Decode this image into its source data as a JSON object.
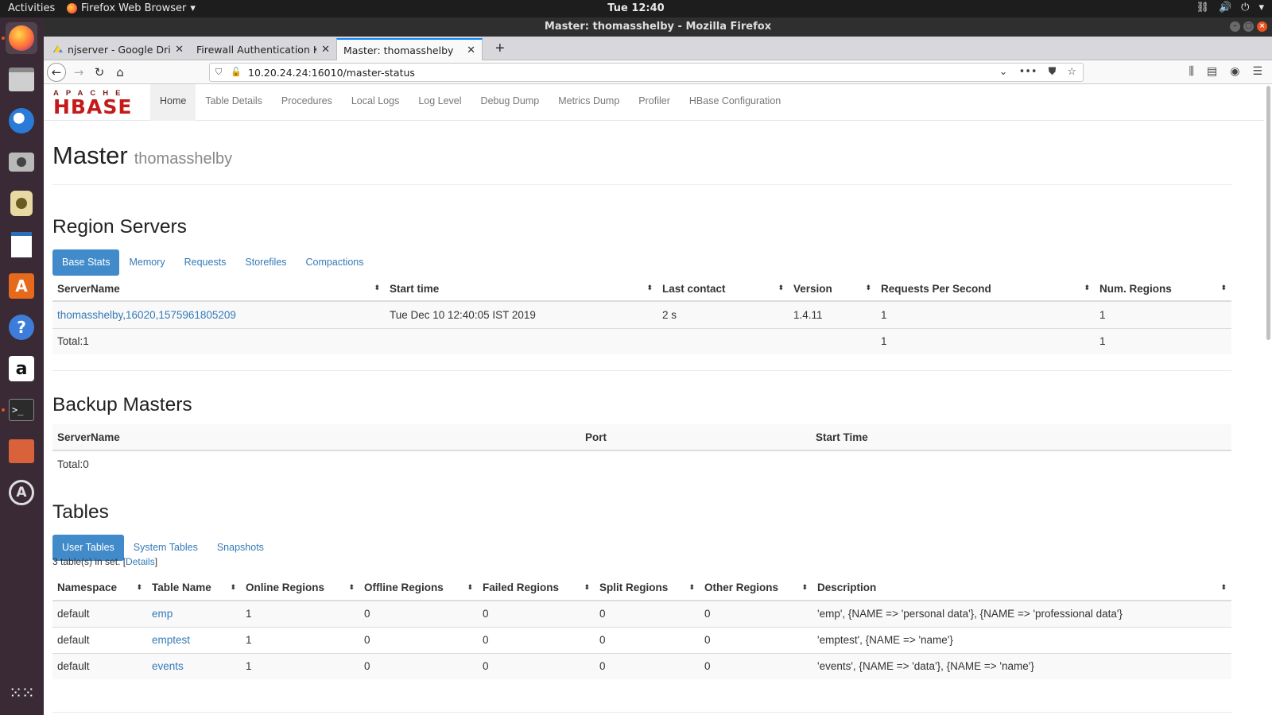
{
  "topbar": {
    "activities": "Activities",
    "app_menu": "Firefox Web Browser",
    "clock": "Tue 12:40"
  },
  "dock": {
    "items": [
      "firefox-icon",
      "files-icon",
      "thunderbird-icon",
      "screenshot-icon",
      "rhythmbox-icon",
      "writer-icon",
      "software-center-icon",
      "help-icon",
      "amazon-icon",
      "terminal-icon",
      "image-viewer-icon",
      "updater-icon",
      "app-grid-icon"
    ]
  },
  "window": {
    "title": "Master: thomasshelby - Mozilla Firefox"
  },
  "tabs": [
    {
      "label": "njserver - Google Drive"
    },
    {
      "label": "Firewall Authentication Kee"
    },
    {
      "label": "Master: thomasshelby"
    }
  ],
  "urlbar": {
    "url": "10.20.24.24:16010/master-status"
  },
  "hbase": {
    "logo_top": "APACHE",
    "logo_bottom": "HBASE",
    "nav": [
      "Home",
      "Table Details",
      "Procedures",
      "Local Logs",
      "Log Level",
      "Debug Dump",
      "Metrics Dump",
      "Profiler",
      "HBase Configuration"
    ]
  },
  "master": {
    "title": "Master",
    "hostname": "thomasshelby"
  },
  "region_servers": {
    "heading": "Region Servers",
    "tabs": [
      "Base Stats",
      "Memory",
      "Requests",
      "Storefiles",
      "Compactions"
    ],
    "columns": [
      "ServerName",
      "Start time",
      "Last contact",
      "Version",
      "Requests Per Second",
      "Num. Regions"
    ],
    "rows": [
      {
        "server": "thomasshelby,16020,1575961805209",
        "start": "Tue Dec 10 12:40:05 IST 2019",
        "last_contact": "2 s",
        "version": "1.4.11",
        "rps": "1",
        "regions": "1"
      }
    ],
    "total": {
      "label": "Total:1",
      "rps": "1",
      "regions": "1"
    }
  },
  "backup_masters": {
    "heading": "Backup Masters",
    "columns": [
      "ServerName",
      "Port",
      "Start Time"
    ],
    "total": "Total:0"
  },
  "tables": {
    "heading": "Tables",
    "tabs": [
      "User Tables",
      "System Tables",
      "Snapshots"
    ],
    "summary_prefix": "3 table(s) in set. [",
    "details_link": "Details",
    "summary_suffix": "]",
    "columns": [
      "Namespace",
      "Table Name",
      "Online Regions",
      "Offline Regions",
      "Failed Regions",
      "Split Regions",
      "Other Regions",
      "Description"
    ],
    "rows": [
      {
        "ns": "default",
        "name": "emp",
        "online": "1",
        "offline": "0",
        "failed": "0",
        "split": "0",
        "other": "0",
        "desc": "'emp', {NAME => 'personal data'}, {NAME => 'professional data'}"
      },
      {
        "ns": "default",
        "name": "emptest",
        "online": "1",
        "offline": "0",
        "failed": "0",
        "split": "0",
        "other": "0",
        "desc": "'emptest', {NAME => 'name'}"
      },
      {
        "ns": "default",
        "name": "events",
        "online": "1",
        "offline": "0",
        "failed": "0",
        "split": "0",
        "other": "0",
        "desc": "'events', {NAME => 'data'}, {NAME => 'name'}"
      }
    ]
  },
  "colors": {
    "accent": "#428bca",
    "link": "#337ab7",
    "hbase_red": "#c41a1a",
    "dock_bg": "#3a2a35"
  }
}
